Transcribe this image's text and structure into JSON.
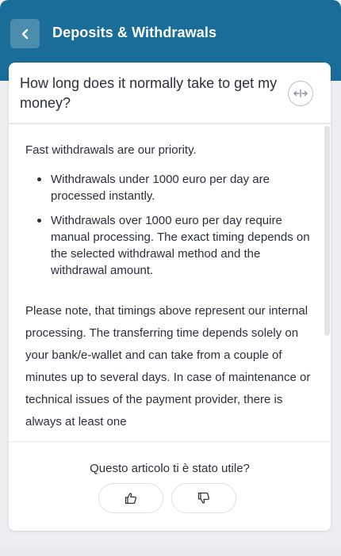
{
  "header": {
    "title": "Deposits & Withdrawals",
    "back_icon": "chevron-left-icon"
  },
  "article": {
    "question": "How long does it normally take to get my money?",
    "expand_icon": "expand-horizontal-icon",
    "intro": "Fast withdrawals are our priority.",
    "bullets": [
      "Withdrawals under 1000 euro per day are processed instantly.",
      "Withdrawals over 1000 euro per day require manual processing. The exact timing depends on the selected withdrawal method and the withdrawal amount."
    ],
    "note": "Please note, that timings above represent our internal processing. The transferring time depends solely on your bank/e-wallet and can take from a couple of minutes up to several days. In case of maintenance or technical issues of the payment provider, there is always at least one"
  },
  "feedback": {
    "question": "Questo articolo ti è stato utile?",
    "thumbs_up_icon": "thumbs-up-icon",
    "thumbs_down_icon": "thumbs-down-icon"
  },
  "colors": {
    "header_bg": "#1a6d98",
    "text": "#2b2f3a",
    "page_bg": "#eceef1"
  }
}
